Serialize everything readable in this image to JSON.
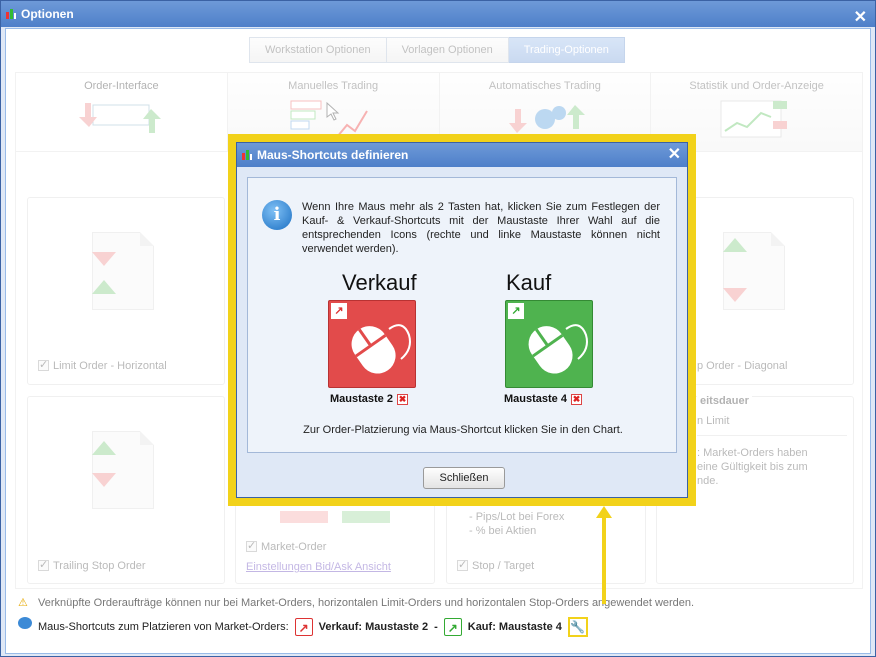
{
  "window": {
    "title": "Optionen"
  },
  "tabs": [
    {
      "label": "Workstation Optionen"
    },
    {
      "label": "Vorlagen Optionen"
    },
    {
      "label": "Trading-Optionen"
    }
  ],
  "sections": [
    {
      "label": "Order-Interface"
    },
    {
      "label": "Manuelles Trading"
    },
    {
      "label": "Automatisches Trading"
    },
    {
      "label": "Statistik und Order-Anzeige"
    }
  ],
  "cards": {
    "limit_horizontal": "Limit Order - Horizontal",
    "stop_diagonal": "p Order - Diagonal",
    "trailing_stop": "Trailing Stop Order",
    "market_order": "Market-Order",
    "bid_ask_link": "Einstellungen Bid/Ask Ansicht",
    "pips_forex": "- Pips/Lot bei Forex",
    "pct_aktien": "- % bei Aktien",
    "stop_target": "Stop / Target",
    "gueltigkeit_title": "eitsdauer",
    "limit_text": "n Limit",
    "market_note_1": ": Market-Orders haben",
    "market_note_2": "eine Gültigkeit bis zum",
    "market_note_3": "nde."
  },
  "footer": {
    "warning": "Verknüpfte Orderaufträge können nur bei Market-Orders, horizontalen Limit-Orders und horizontalen Stop-Orders angewendet werden.",
    "shortcuts_label": "Maus-Shortcuts zum Platzieren von Market-Orders:",
    "verkauf": "Verkauf: Maustaste 2",
    "dash": "-",
    "kauf": "Kauf: Maustaste 4"
  },
  "dialog": {
    "title": "Maus-Shortcuts definieren",
    "info": "Wenn Ihre Maus mehr als 2 Tasten hat, klicken Sie zum Festlegen der Kauf- & Verkauf-Shortcuts mit der Maustaste Ihrer Wahl auf die entsprechenden Icons (rechte und linke Maustaste können nicht verwendet werden).",
    "sell_label": "Verkauf",
    "buy_label": "Kauf",
    "sell_caption": "Maustaste 2",
    "buy_caption": "Maustaste 4",
    "hint": "Zur Order-Platzierung via Maus-Shortcut klicken Sie in den Chart.",
    "close_button": "Schließen"
  },
  "colors": {
    "sell": "#e24b4b",
    "buy": "#4fb34f",
    "highlight": "#f2d21a",
    "titlebar": "#4e7fc9"
  }
}
